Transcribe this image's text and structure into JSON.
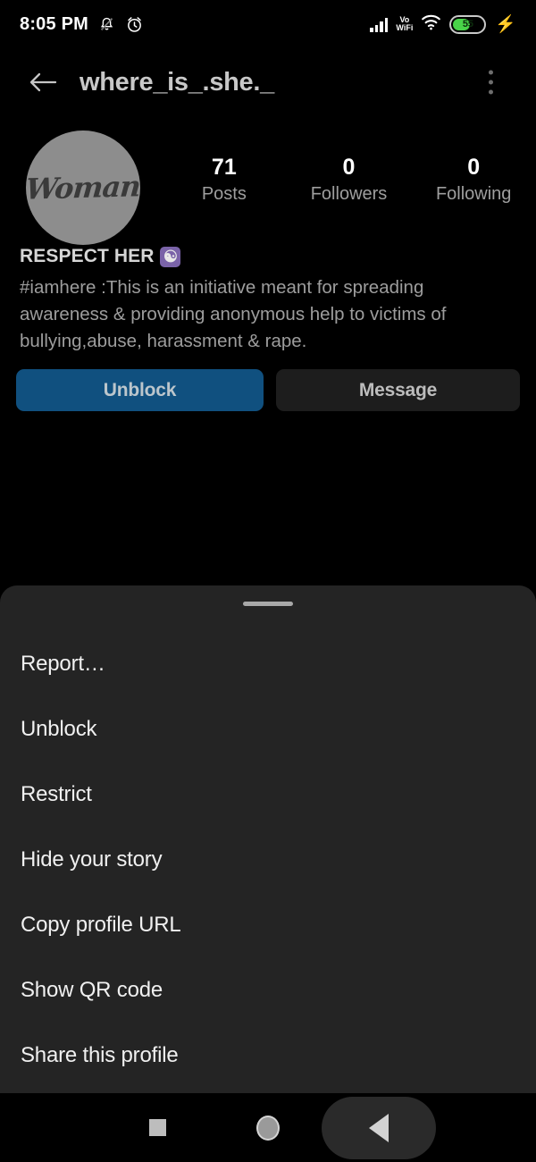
{
  "status_bar": {
    "time": "8:05 PM",
    "notification_icon": "bell-muted-icon",
    "alarm_icon": "alarm-clock-icon",
    "signal_icon": "cellular-signal-icon",
    "network_line1": "Vo",
    "network_line2": "WiFi",
    "wifi_icon": "wifi-icon",
    "battery_percent": "55",
    "charging_icon": "charging-bolt-icon"
  },
  "app_bar": {
    "back_icon": "back-arrow-icon",
    "username": "where_is_.she._",
    "overflow_icon": "kebab-menu-icon"
  },
  "profile": {
    "avatar_text": "Woman",
    "stats": [
      {
        "value": "71",
        "label": "Posts"
      },
      {
        "value": "0",
        "label": "Followers"
      },
      {
        "value": "0",
        "label": "Following"
      }
    ],
    "bio_title": "RESPECT HER",
    "bio_emoji": "☯",
    "bio_body": "#iamhere :This is an initiative meant for spreading awareness & providing anonymous help to victims of bullying,abuse, harassment & rape."
  },
  "actions": {
    "unblock_label": "Unblock",
    "message_label": "Message",
    "unblock_color": "#10507f",
    "message_color": "#1d1d1d"
  },
  "sheet": {
    "handle": "drag-handle",
    "items": [
      {
        "label": "Report…"
      },
      {
        "label": "Unblock"
      },
      {
        "label": "Restrict"
      },
      {
        "label": "Hide your story"
      },
      {
        "label": "Copy profile URL"
      },
      {
        "label": "Show QR code"
      },
      {
        "label": "Share this profile"
      }
    ]
  },
  "nav_bar": {
    "recents_icon": "square-recents-icon",
    "home_icon": "circle-home-icon",
    "back_icon": "triangle-back-icon"
  }
}
